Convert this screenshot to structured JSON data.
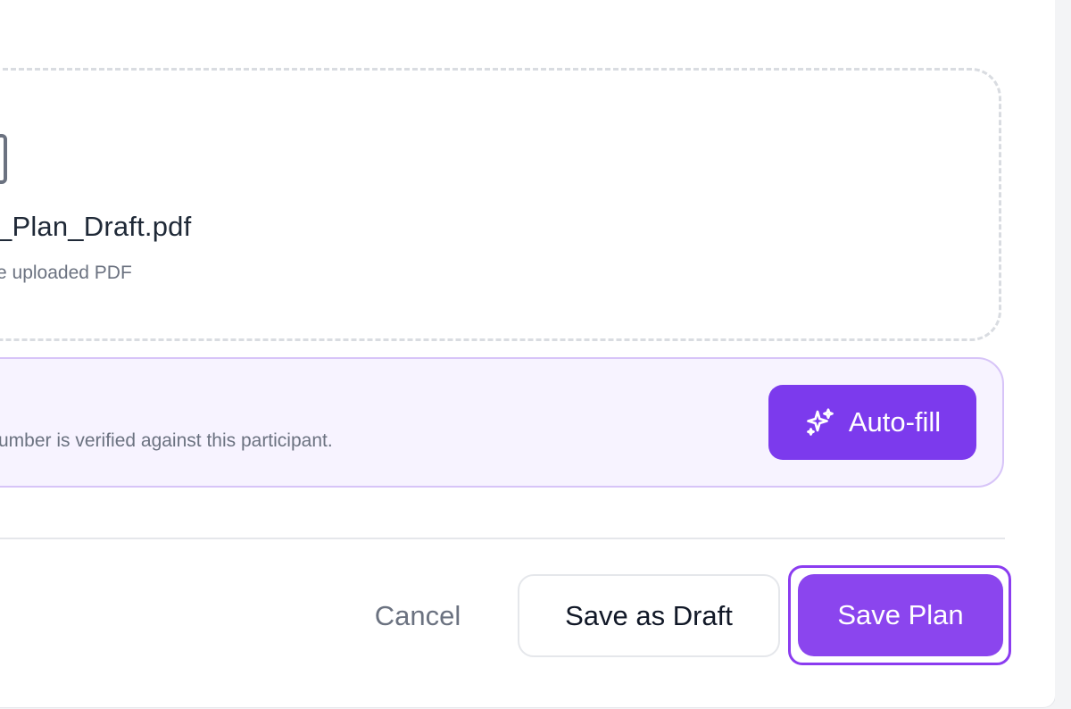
{
  "upload": {
    "file_name": "_Plan_Draft.pdf",
    "subtitle": "e uploaded PDF"
  },
  "autofill": {
    "description": "umber is verified against this participant.",
    "button_label": "Auto-fill",
    "icon": "sparkles-icon"
  },
  "footer": {
    "cancel_label": "Cancel",
    "draft_label": "Save as Draft",
    "save_label": "Save Plan"
  },
  "colors": {
    "accent": "#7c3aed",
    "accent_focus": "#8b3cf0",
    "panel_bg": "#f7f3ff"
  }
}
